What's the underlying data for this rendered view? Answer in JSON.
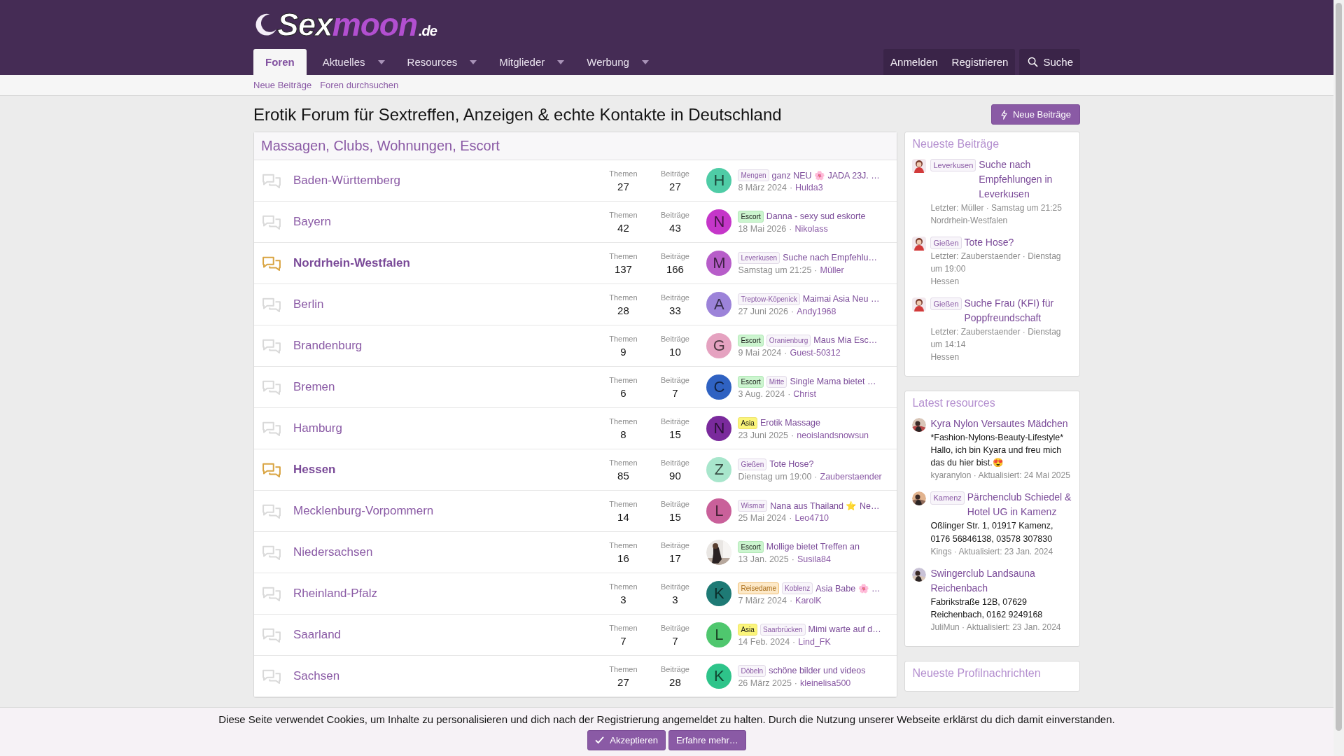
{
  "logo": {
    "primary": "Sex",
    "accent": "moon",
    "suffix": ".de"
  },
  "nav": {
    "tabs": [
      {
        "label": "Foren",
        "selected": true,
        "dropdown": false
      },
      {
        "label": "Aktuelles",
        "selected": false,
        "dropdown": true
      },
      {
        "label": "Resources",
        "selected": false,
        "dropdown": true
      },
      {
        "label": "Mitglieder",
        "selected": false,
        "dropdown": true
      },
      {
        "label": "Werbung",
        "selected": false,
        "dropdown": true
      }
    ],
    "account": [
      "Anmelden",
      "Registrieren"
    ],
    "search": "Suche"
  },
  "subnav": [
    "Neue Beiträge",
    "Foren durchsuchen"
  ],
  "page_title": "Erotik Forum für Sextreffen, Anzeigen & echte Kontakte in Deutschland",
  "new_posts_button": "Neue Beiträge",
  "category": {
    "title": "Massagen, Clubs, Wohnungen, Escort",
    "forums": [
      {
        "name": "Baden-Württemberg",
        "unread": false,
        "threads_label": "Themen",
        "threads": "27",
        "posts_label": "Beiträge",
        "posts": "27",
        "last": {
          "avatar": {
            "kind": "letter",
            "letter": "H",
            "color": "#4fcca6"
          },
          "tags": [
            {
              "kind": "region",
              "label": "Mengen"
            }
          ],
          "title": "ganz NEU 🌸 JADA 23J. …",
          "date": "8 März 2024",
          "separator": "·",
          "user": "Hulda3"
        }
      },
      {
        "name": "Bayern",
        "unread": false,
        "threads_label": "Themen",
        "threads": "42",
        "posts_label": "Beiträge",
        "posts": "43",
        "last": {
          "avatar": {
            "kind": "letter",
            "letter": "N",
            "color": "#c536c9"
          },
          "tags": [
            {
              "kind": "escort",
              "label": "Escort"
            }
          ],
          "title": "Danna - sexy sud eskorte",
          "date": "18 Mai 2026",
          "separator": "·",
          "user": "Nikolass"
        }
      },
      {
        "name": "Nordrhein-Westfalen",
        "unread": true,
        "threads_label": "Themen",
        "threads": "137",
        "posts_label": "Beiträge",
        "posts": "166",
        "last": {
          "avatar": {
            "kind": "letter",
            "letter": "M",
            "color": "#b75dc9"
          },
          "tags": [
            {
              "kind": "region",
              "label": "Leverkusen"
            }
          ],
          "title": "Suche nach Empfehlu…",
          "date": "Samstag um 21:25",
          "separator": "·",
          "user": "Müller"
        }
      },
      {
        "name": "Berlin",
        "unread": false,
        "threads_label": "Themen",
        "threads": "28",
        "posts_label": "Beiträge",
        "posts": "33",
        "last": {
          "avatar": {
            "kind": "letter",
            "letter": "A",
            "color": "#9c83d9"
          },
          "tags": [
            {
              "kind": "region",
              "label": "Treptow-Köpenick"
            }
          ],
          "title": "Maimai Asia Neu …",
          "date": "27 Juni 2026",
          "separator": "·",
          "user": "Andy1968"
        }
      },
      {
        "name": "Brandenburg",
        "unread": false,
        "threads_label": "Themen",
        "threads": "9",
        "posts_label": "Beiträge",
        "posts": "10",
        "last": {
          "avatar": {
            "kind": "letter",
            "letter": "G",
            "color": "#e5a2c0"
          },
          "tags": [
            {
              "kind": "escort",
              "label": "Escort"
            },
            {
              "kind": "region",
              "label": "Oranienburg"
            }
          ],
          "title": "Maus Mia Esc…",
          "date": "9 Mai 2024",
          "separator": "·",
          "user": "Guest-50312"
        }
      },
      {
        "name": "Bremen",
        "unread": false,
        "threads_label": "Themen",
        "threads": "6",
        "posts_label": "Beiträge",
        "posts": "7",
        "last": {
          "avatar": {
            "kind": "letter",
            "letter": "C",
            "color": "#2f62c2"
          },
          "tags": [
            {
              "kind": "escort",
              "label": "Escort"
            },
            {
              "kind": "region",
              "label": "Mitte"
            }
          ],
          "title": "Single Mama bietet …",
          "date": "3 Aug. 2024",
          "separator": "·",
          "user": "Christ"
        }
      },
      {
        "name": "Hamburg",
        "unread": false,
        "threads_label": "Themen",
        "threads": "8",
        "posts_label": "Beiträge",
        "posts": "15",
        "last": {
          "avatar": {
            "kind": "letter",
            "letter": "N",
            "color": "#7a2a9c"
          },
          "tags": [
            {
              "kind": "asia",
              "label": "Asia"
            }
          ],
          "title": "Erotik Massage",
          "date": "23 Juni 2025",
          "separator": "·",
          "user": "neoislandsnowsun"
        }
      },
      {
        "name": "Hessen",
        "unread": true,
        "threads_label": "Themen",
        "threads": "85",
        "posts_label": "Beiträge",
        "posts": "90",
        "last": {
          "avatar": {
            "kind": "letter",
            "letter": "Z",
            "color": "#a8e6cc"
          },
          "tags": [
            {
              "kind": "region",
              "label": "Gießen"
            }
          ],
          "title": "Tote Hose?",
          "date": "Dienstag um 19:00",
          "separator": "·",
          "user": "Zauberstaender"
        }
      },
      {
        "name": "Mecklenburg-Vorpommern",
        "unread": false,
        "threads_label": "Themen",
        "threads": "14",
        "posts_label": "Beiträge",
        "posts": "15",
        "last": {
          "avatar": {
            "kind": "letter",
            "letter": "L",
            "color": "#c9609a"
          },
          "tags": [
            {
              "kind": "region",
              "label": "Wismar"
            }
          ],
          "title": "Nana aus Thailand ⭐ Ne…",
          "date": "25 Mai 2024",
          "separator": "·",
          "user": "Leo4710"
        }
      },
      {
        "name": "Niedersachsen",
        "unread": false,
        "threads_label": "Themen",
        "threads": "16",
        "posts_label": "Beiträge",
        "posts": "17",
        "last": {
          "tags": [
            {
              "kind": "escort",
              "label": "Escort"
            }
          ],
          "title": "Mollige bietet Treffen an",
          "date": "13 Jan. 2025",
          "separator": "·",
          "user": "Susila84"
        }
      },
      {
        "name": "Rheinland-Pfalz",
        "unread": false,
        "threads_label": "Themen",
        "threads": "3",
        "posts_label": "Beiträge",
        "posts": "3",
        "last": {
          "avatar": {
            "kind": "letter",
            "letter": "K",
            "color": "#1e7a75"
          },
          "tags": [
            {
              "kind": "travel",
              "label": "Reisedame"
            },
            {
              "kind": "region",
              "label": "Koblenz"
            }
          ],
          "title": "Asia Babe 🌸 …",
          "date": "7 März 2024",
          "separator": "·",
          "user": "KarolK"
        }
      },
      {
        "name": "Saarland",
        "unread": false,
        "threads_label": "Themen",
        "threads": "7",
        "posts_label": "Beiträge",
        "posts": "7",
        "last": {
          "avatar": {
            "kind": "letter",
            "letter": "L",
            "color": "#4fc76e"
          },
          "tags": [
            {
              "kind": "asia",
              "label": "Asia"
            },
            {
              "kind": "region",
              "label": "Saarbrücken"
            }
          ],
          "title": "Mimi warte auf d…",
          "date": "14 Feb. 2024",
          "separator": "·",
          "user": "Lind_FK"
        }
      },
      {
        "name": "Sachsen",
        "unread": false,
        "threads_label": "Themen",
        "threads": "27",
        "posts_label": "Beiträge",
        "posts": "28",
        "last": {
          "avatar": {
            "kind": "letter",
            "letter": "K",
            "color": "#2ec48a"
          },
          "tags": [
            {
              "kind": "region",
              "label": "Döbeln"
            }
          ],
          "title": "schöne bilder und videos",
          "date": "26 März 2025",
          "separator": "·",
          "user": "kleinelisa500"
        }
      }
    ]
  },
  "sidebar": {
    "new_posts": {
      "title": "Neueste Beiträge",
      "items": [
        {
          "tags": [
            {
              "kind": "region",
              "label": "Leverkusen"
            }
          ],
          "title": "Suche nach Empfehlungen in Leverkusen",
          "meta": "Letzter: Müller · Samstag um 21:25",
          "forum": "Nordrhein-Westfalen"
        },
        {
          "tags": [
            {
              "kind": "region",
              "label": "Gießen"
            }
          ],
          "title": "Tote Hose?",
          "meta": "Letzter: Zauberstaender · Dienstag um 19:00",
          "forum": "Hessen"
        },
        {
          "tags": [
            {
              "kind": "region",
              "label": "Gießen"
            }
          ],
          "title": "Suche Frau (KFI) für Poppfreundschaft",
          "meta": "Letzter: Zauberstaender · Dienstag um 14:14",
          "forum": "Hessen"
        }
      ]
    },
    "resources": {
      "title": "Latest resources",
      "items": [
        {
          "title": "Kyra Nylon Versautes Mädchen",
          "description": "*Fashion-Nylons-Beauty-Lifestyle*\nHallo, ich bin Kyara und freu mich das du hier bist.😍",
          "meta": "kyaranylon · Aktualisiert: 24 Mai 2025"
        },
        {
          "tags": [
            {
              "kind": "region",
              "label": "Kamenz"
            }
          ],
          "title": "Pärchenclub Schiedel & Hotel UG in Kamenz",
          "description": "Oßlinger Str. 1, 01917 Kamenz, 0176 56846138, 03578 307830",
          "meta": "Kings · Aktualisiert: 23 Jan. 2024"
        },
        {
          "title": "Swingerclub Landsauna Reichenbach",
          "description": "Fabrikstraße 12B, 07629 Reichenbach, 0162 9249168",
          "meta": "JuliMun · Aktualisiert: 23 Jan. 2024"
        }
      ]
    },
    "profile_posts": {
      "title": "Neueste Profilnachrichten"
    }
  },
  "cookie_notice": {
    "text": "Diese Seite verwendet Cookies, um Inhalte zu personalisieren und dich nach der Registrierung angemeldet zu halten. Durch die Nutzung unserer Webseite erklärst du dich damit einverstanden.",
    "accept": "Akzeptieren",
    "more": "Erfahre mehr…"
  }
}
